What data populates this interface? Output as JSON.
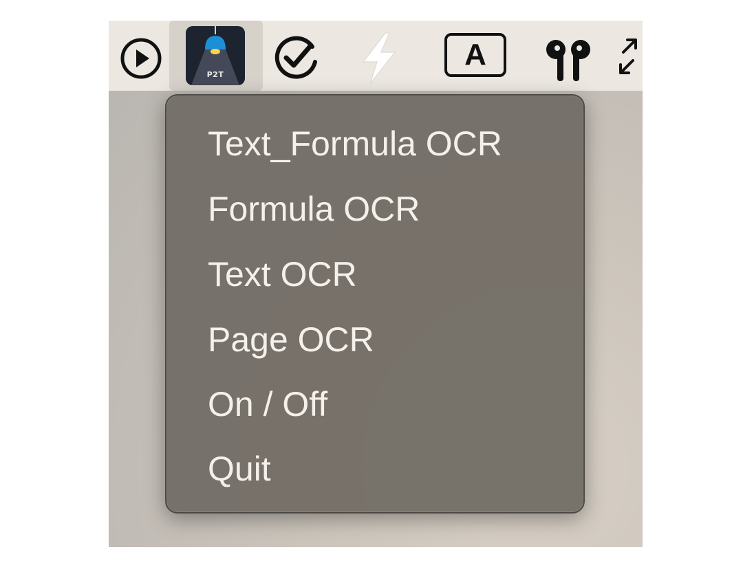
{
  "menubar": {
    "items": [
      {
        "icon": "play-circle-icon"
      },
      {
        "icon": "p2t-app-icon",
        "label": "P2T"
      },
      {
        "icon": "checkmark-circle-icon"
      },
      {
        "icon": "lightning-bolt-icon"
      },
      {
        "icon": "input-source-icon",
        "label": "A"
      },
      {
        "icon": "airpods-icon"
      },
      {
        "icon": "resize-arrows-icon"
      }
    ]
  },
  "menu": {
    "items": [
      {
        "label": "Text_Formula OCR"
      },
      {
        "label": "Formula OCR"
      },
      {
        "label": "Text OCR"
      },
      {
        "label": "Page OCR"
      },
      {
        "label": "On / Off"
      },
      {
        "label": "Quit"
      }
    ]
  },
  "colors": {
    "menu_background": "#746e67",
    "menu_text": "#f4f1ec",
    "menubar_background": "#ece8e1",
    "app_icon_background": "#1e2330",
    "lamp_blue": "#1c8fd6"
  }
}
